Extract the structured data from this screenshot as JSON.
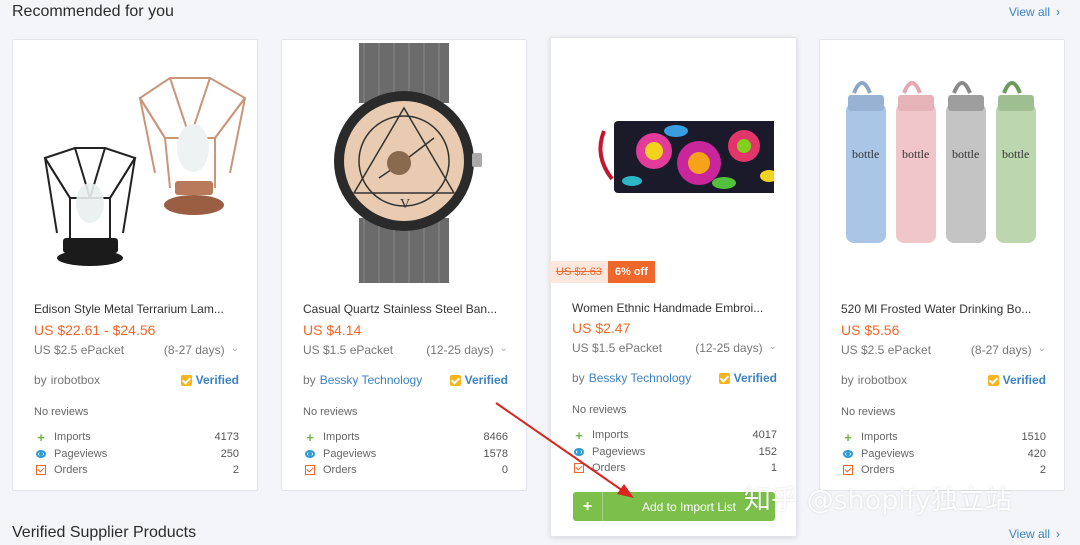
{
  "header": {
    "title": "Recommended for you",
    "view_all": "View all"
  },
  "footer_section": {
    "title": "Verified Supplier Products",
    "view_all": "View all"
  },
  "products": [
    {
      "title": "Edison Style Metal Terrarium Lam...",
      "price": "US $22.61 - $24.56",
      "shipping": "US $2.5 ePacket",
      "days": "(8-27 days)",
      "by": "by",
      "seller": "irobotbox",
      "verified": "Verified",
      "reviews": "No reviews",
      "imports_label": "Imports",
      "imports": "4173",
      "pageviews_label": "Pageviews",
      "pageviews": "250",
      "orders_label": "Orders",
      "orders": "2",
      "image_icon": "edison-lamp-image"
    },
    {
      "title": "Casual Quartz Stainless Steel Ban...",
      "price": "US $4.14",
      "shipping": "US $1.5 ePacket",
      "days": "(12-25 days)",
      "by": "by",
      "seller": "Bessky Technology",
      "verified": "Verified",
      "reviews": "No reviews",
      "imports_label": "Imports",
      "imports": "8466",
      "pageviews_label": "Pageviews",
      "pageviews": "1578",
      "orders_label": "Orders",
      "orders": "0",
      "image_icon": "watch-image"
    },
    {
      "title": "Women Ethnic Handmade Embroi...",
      "price": "US $2.47",
      "old_price": "US $2.63",
      "discount": "6% off",
      "shipping": "US $1.5 ePacket",
      "days": "(12-25 days)",
      "by": "by",
      "seller": "Bessky Technology",
      "verified": "Verified",
      "reviews": "No reviews",
      "imports_label": "Imports",
      "imports": "4017",
      "pageviews_label": "Pageviews",
      "pageviews": "152",
      "orders_label": "Orders",
      "orders": "1",
      "add_button": "Add to Import List",
      "image_icon": "embroidered-wallet-image"
    },
    {
      "title": "520 Ml Frosted Water Drinking Bo...",
      "price": "US $5.56",
      "shipping": "US $2.5 ePacket",
      "days": "(8-27 days)",
      "by": "by",
      "seller": "irobotbox",
      "verified": "Verified",
      "reviews": "No reviews",
      "imports_label": "Imports",
      "imports": "1510",
      "pageviews_label": "Pageviews",
      "pageviews": "420",
      "orders_label": "Orders",
      "orders": "2",
      "bottle_label": "bottle",
      "image_icon": "water-bottles-image"
    }
  ],
  "watermark": "知乎 @shopify独立站",
  "colors": {
    "accent": "#3b82c4",
    "price": "#f0672b",
    "verified_badge": "#f6b51e",
    "add_button": "#7cc04b",
    "annotation_arrow": "#d9251d"
  }
}
